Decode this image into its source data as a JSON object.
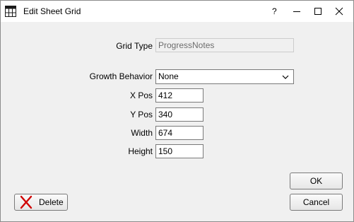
{
  "window": {
    "title": "Edit Sheet Grid",
    "help_label": "?"
  },
  "form": {
    "grid_type": {
      "label": "Grid Type",
      "value": "ProgressNotes"
    },
    "growth_behavior": {
      "label": "Growth Behavior",
      "value": "None"
    },
    "x_pos": {
      "label": "X Pos",
      "value": "412"
    },
    "y_pos": {
      "label": "Y Pos",
      "value": "340"
    },
    "width": {
      "label": "Width",
      "value": "674"
    },
    "height": {
      "label": "Height",
      "value": "150"
    }
  },
  "buttons": {
    "ok": "OK",
    "cancel": "Cancel",
    "delete": "Delete"
  },
  "colors": {
    "delete_icon": "#d00000",
    "dropdown_border": "#7a7a7a"
  },
  "icons": {
    "app": "grid-icon",
    "minimize": "minimize-icon",
    "maximize": "maximize-icon",
    "close": "close-icon",
    "dropdown": "chevron-down-icon",
    "delete": "red-x-icon"
  }
}
